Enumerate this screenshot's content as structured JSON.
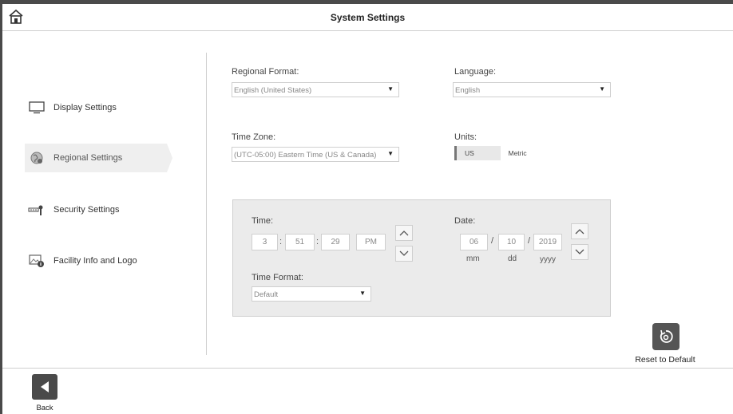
{
  "header": {
    "title": "System Settings",
    "home_icon": "home-icon"
  },
  "sidebar": {
    "items": [
      {
        "label": "Display Settings",
        "icon": "monitor-icon"
      },
      {
        "label": "Regional Settings",
        "icon": "globe-icon",
        "active": true
      },
      {
        "label": "Security Settings",
        "icon": "key-icon"
      },
      {
        "label": "Facility Info and Logo",
        "icon": "image-info-icon"
      }
    ]
  },
  "regional": {
    "format_label": "Regional Format:",
    "format_value": "English (United States)",
    "language_label": "Language:",
    "language_value": "English",
    "timezone_label": "Time Zone:",
    "timezone_value": "(UTC-05:00) Eastern Time (US & Canada)",
    "units_label": "Units:",
    "units_options": [
      "US",
      "Metric"
    ],
    "units_selected": "US"
  },
  "time": {
    "label": "Time:",
    "hour": "3",
    "minute": "51",
    "second": "29",
    "ampm": "PM",
    "separator": ":",
    "format_label": "Time Format:",
    "format_value": "Default"
  },
  "date": {
    "label": "Date:",
    "month": "06",
    "day": "10",
    "year": "2019",
    "separator": "/",
    "month_hint": "mm",
    "day_hint": "dd",
    "year_hint": "yyyy"
  },
  "actions": {
    "reset_label": "Reset to Default",
    "back_label": "Back"
  }
}
